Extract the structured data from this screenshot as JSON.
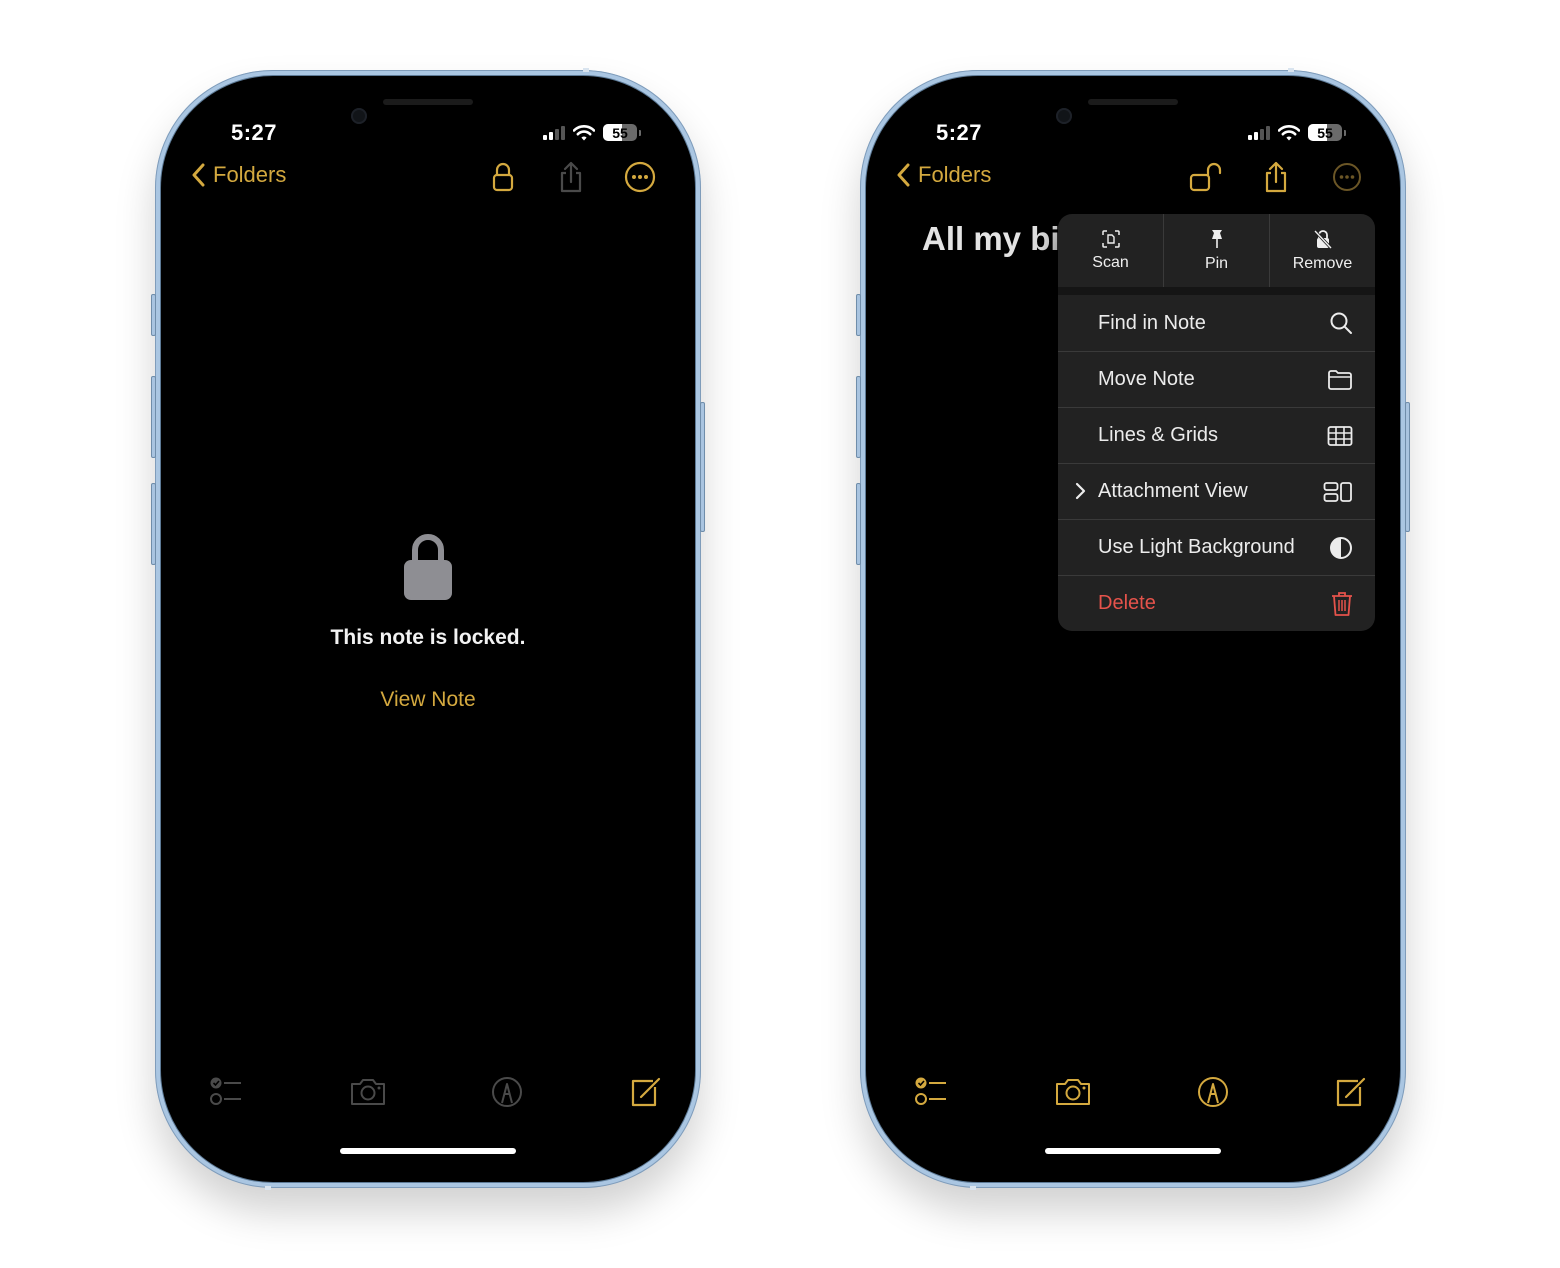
{
  "colors": {
    "accent": "#d4a93f",
    "danger": "#e5534b",
    "inactive": "#4a4a4a",
    "lock_gray": "#8e8e93"
  },
  "left_phone": {
    "status_bar": {
      "time": "5:27",
      "battery_percent": "55"
    },
    "navbar": {
      "back_label": "Folders",
      "icons": [
        "lock-icon",
        "share-icon",
        "more-icon"
      ]
    },
    "locked": {
      "message": "This note is locked.",
      "view_button": "View Note"
    },
    "toolbar": {
      "icons": [
        "checklist-icon",
        "camera-icon",
        "markup-icon",
        "compose-icon"
      ]
    }
  },
  "right_phone": {
    "status_bar": {
      "time": "5:27",
      "battery_percent": "55"
    },
    "navbar": {
      "back_label": "Folders",
      "icons": [
        "unlock-icon",
        "share-icon",
        "more-icon"
      ]
    },
    "note_title": "All my bi",
    "menu": {
      "top_actions": [
        {
          "label": "Scan",
          "icon": "scan-document-icon"
        },
        {
          "label": "Pin",
          "icon": "pin-icon"
        },
        {
          "label": "Remove",
          "icon": "remove-lock-icon"
        }
      ],
      "items": [
        {
          "label": "Find in Note",
          "icon": "search-icon"
        },
        {
          "label": "Move Note",
          "icon": "folder-icon"
        },
        {
          "label": "Lines & Grids",
          "icon": "grid-icon"
        },
        {
          "label": "Attachment View",
          "icon": "attachment-view-icon",
          "has_submenu": true
        },
        {
          "label": "Use Light Background",
          "icon": "half-circle-icon"
        },
        {
          "label": "Delete",
          "icon": "trash-icon",
          "destructive": true
        }
      ]
    },
    "toolbar": {
      "icons": [
        "checklist-icon",
        "camera-icon",
        "markup-icon",
        "compose-icon"
      ]
    }
  }
}
